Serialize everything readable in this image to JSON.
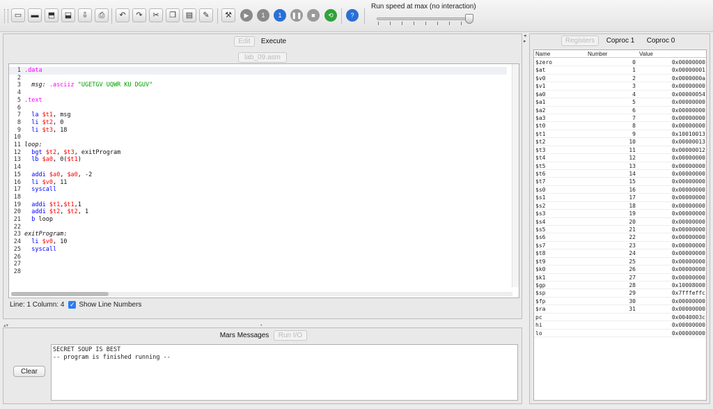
{
  "toolbar": {
    "icons": [
      "new-file-icon",
      "open-file-icon",
      "save-icon",
      "save-as-icon",
      "dump-memory-icon",
      "print-icon",
      "undo-icon",
      "redo-icon",
      "cut-icon",
      "copy-icon",
      "paste-icon",
      "find-replace-icon",
      "assemble-icon",
      "run-icon",
      "step-icon",
      "backstep-icon",
      "pause-icon",
      "stop-icon",
      "reset-icon",
      "help-icon"
    ],
    "speed_label": "Run speed at max (no interaction)"
  },
  "editor_tabs": {
    "edit": "Edit",
    "execute": "Execute"
  },
  "file_tab": "lab_09.asm",
  "editor": {
    "lines": [
      {
        "n": "1",
        "parts": [
          {
            "t": ".data",
            "c": "dir"
          }
        ]
      },
      {
        "n": "2",
        "parts": []
      },
      {
        "n": "3",
        "parts": [
          {
            "t": "  msg: ",
            "c": "lbl"
          },
          {
            "t": ".asciiz ",
            "c": "dir"
          },
          {
            "t": "\"UGETGV UQWR KU DGUV\"",
            "c": "str"
          }
        ]
      },
      {
        "n": "4",
        "parts": []
      },
      {
        "n": "5",
        "parts": [
          {
            "t": ".text",
            "c": "dir"
          }
        ]
      },
      {
        "n": "6",
        "parts": []
      },
      {
        "n": "7",
        "parts": [
          {
            "t": "  la ",
            "c": "kw"
          },
          {
            "t": "$t1",
            "c": "reg"
          },
          {
            "t": ", msg",
            "c": "txt"
          }
        ]
      },
      {
        "n": "8",
        "parts": [
          {
            "t": "  li ",
            "c": "kw"
          },
          {
            "t": "$t2",
            "c": "reg"
          },
          {
            "t": ", 0",
            "c": "txt"
          }
        ]
      },
      {
        "n": "9",
        "parts": [
          {
            "t": "  li ",
            "c": "kw"
          },
          {
            "t": "$t3",
            "c": "reg"
          },
          {
            "t": ", 18",
            "c": "txt"
          }
        ]
      },
      {
        "n": "10",
        "parts": []
      },
      {
        "n": "11",
        "parts": [
          {
            "t": "loop:",
            "c": "lbl"
          }
        ]
      },
      {
        "n": "12",
        "parts": [
          {
            "t": "  bgt ",
            "c": "kw"
          },
          {
            "t": "$t2",
            "c": "reg"
          },
          {
            "t": ", ",
            "c": "txt"
          },
          {
            "t": "$t3",
            "c": "reg"
          },
          {
            "t": ", exitProgram",
            "c": "txt"
          }
        ]
      },
      {
        "n": "13",
        "parts": [
          {
            "t": "  lb ",
            "c": "kw"
          },
          {
            "t": "$a0",
            "c": "reg"
          },
          {
            "t": ", 0(",
            "c": "txt"
          },
          {
            "t": "$t1",
            "c": "reg"
          },
          {
            "t": ")",
            "c": "txt"
          }
        ]
      },
      {
        "n": "14",
        "parts": []
      },
      {
        "n": "15",
        "parts": [
          {
            "t": "  addi ",
            "c": "kw"
          },
          {
            "t": "$a0",
            "c": "reg"
          },
          {
            "t": ", ",
            "c": "txt"
          },
          {
            "t": "$a0",
            "c": "reg"
          },
          {
            "t": ", -2",
            "c": "txt"
          }
        ]
      },
      {
        "n": "16",
        "parts": [
          {
            "t": "  li ",
            "c": "kw"
          },
          {
            "t": "$v0",
            "c": "reg"
          },
          {
            "t": ", 11",
            "c": "txt"
          }
        ]
      },
      {
        "n": "17",
        "parts": [
          {
            "t": "  syscall",
            "c": "kw"
          }
        ]
      },
      {
        "n": "18",
        "parts": []
      },
      {
        "n": "19",
        "parts": [
          {
            "t": "  addi ",
            "c": "kw"
          },
          {
            "t": "$t1",
            "c": "reg"
          },
          {
            "t": ",",
            "c": "txt"
          },
          {
            "t": "$t1",
            "c": "reg"
          },
          {
            "t": ",1",
            "c": "txt"
          }
        ]
      },
      {
        "n": "20",
        "parts": [
          {
            "t": "  addi ",
            "c": "kw"
          },
          {
            "t": "$t2",
            "c": "reg"
          },
          {
            "t": ", ",
            "c": "txt"
          },
          {
            "t": "$t2",
            "c": "reg"
          },
          {
            "t": ", 1",
            "c": "txt"
          }
        ]
      },
      {
        "n": "21",
        "parts": [
          {
            "t": "  b ",
            "c": "kw"
          },
          {
            "t": "loop",
            "c": "txt"
          }
        ]
      },
      {
        "n": "22",
        "parts": []
      },
      {
        "n": "23",
        "parts": [
          {
            "t": "exitProgram:",
            "c": "lbl"
          }
        ]
      },
      {
        "n": "24",
        "parts": [
          {
            "t": "  li ",
            "c": "kw"
          },
          {
            "t": "$v0",
            "c": "reg"
          },
          {
            "t": ", 10",
            "c": "txt"
          }
        ]
      },
      {
        "n": "25",
        "parts": [
          {
            "t": "  syscall",
            "c": "kw"
          }
        ]
      },
      {
        "n": "26",
        "parts": []
      },
      {
        "n": "27",
        "parts": []
      },
      {
        "n": "28",
        "parts": []
      }
    ]
  },
  "status": {
    "line_col": "Line: 1 Column: 4",
    "show_line_numbers": "Show Line Numbers"
  },
  "messages": {
    "tabs": {
      "mars": "Mars Messages",
      "run_io": "Run I/O"
    },
    "output_lines": [
      "SECRET SOUP IS BEST",
      "-- program is finished running --"
    ],
    "clear": "Clear"
  },
  "registers": {
    "tabs": {
      "registers": "Registers",
      "coproc1": "Coproc 1",
      "coproc0": "Coproc 0"
    },
    "headers": {
      "name": "Name",
      "number": "Number",
      "value": "Value"
    },
    "rows": [
      {
        "name": "$zero",
        "num": "0",
        "val": "0x00000000"
      },
      {
        "name": "$at",
        "num": "1",
        "val": "0x00000001"
      },
      {
        "name": "$v0",
        "num": "2",
        "val": "0x0000000a"
      },
      {
        "name": "$v1",
        "num": "3",
        "val": "0x00000000"
      },
      {
        "name": "$a0",
        "num": "4",
        "val": "0x00000054"
      },
      {
        "name": "$a1",
        "num": "5",
        "val": "0x00000000"
      },
      {
        "name": "$a2",
        "num": "6",
        "val": "0x00000000"
      },
      {
        "name": "$a3",
        "num": "7",
        "val": "0x00000000"
      },
      {
        "name": "$t0",
        "num": "8",
        "val": "0x00000000"
      },
      {
        "name": "$t1",
        "num": "9",
        "val": "0x10010013"
      },
      {
        "name": "$t2",
        "num": "10",
        "val": "0x00000013"
      },
      {
        "name": "$t3",
        "num": "11",
        "val": "0x00000012"
      },
      {
        "name": "$t4",
        "num": "12",
        "val": "0x00000000"
      },
      {
        "name": "$t5",
        "num": "13",
        "val": "0x00000000"
      },
      {
        "name": "$t6",
        "num": "14",
        "val": "0x00000000"
      },
      {
        "name": "$t7",
        "num": "15",
        "val": "0x00000000"
      },
      {
        "name": "$s0",
        "num": "16",
        "val": "0x00000000"
      },
      {
        "name": "$s1",
        "num": "17",
        "val": "0x00000000"
      },
      {
        "name": "$s2",
        "num": "18",
        "val": "0x00000000"
      },
      {
        "name": "$s3",
        "num": "19",
        "val": "0x00000000"
      },
      {
        "name": "$s4",
        "num": "20",
        "val": "0x00000000"
      },
      {
        "name": "$s5",
        "num": "21",
        "val": "0x00000000"
      },
      {
        "name": "$s6",
        "num": "22",
        "val": "0x00000000"
      },
      {
        "name": "$s7",
        "num": "23",
        "val": "0x00000000"
      },
      {
        "name": "$t8",
        "num": "24",
        "val": "0x00000000"
      },
      {
        "name": "$t9",
        "num": "25",
        "val": "0x00000000"
      },
      {
        "name": "$k0",
        "num": "26",
        "val": "0x00000000"
      },
      {
        "name": "$k1",
        "num": "27",
        "val": "0x00000000"
      },
      {
        "name": "$gp",
        "num": "28",
        "val": "0x10008000"
      },
      {
        "name": "$sp",
        "num": "29",
        "val": "0x7fffeffc"
      },
      {
        "name": "$fp",
        "num": "30",
        "val": "0x00000000"
      },
      {
        "name": "$ra",
        "num": "31",
        "val": "0x00000000"
      },
      {
        "name": "pc",
        "num": "",
        "val": "0x0040003c"
      },
      {
        "name": "hi",
        "num": "",
        "val": "0x00000000"
      },
      {
        "name": "lo",
        "num": "",
        "val": "0x00000000"
      }
    ]
  },
  "colors": {
    "directive": "#ff00ff",
    "string": "#00a000",
    "keyword": "#0000ff",
    "register": "#ff0000"
  }
}
